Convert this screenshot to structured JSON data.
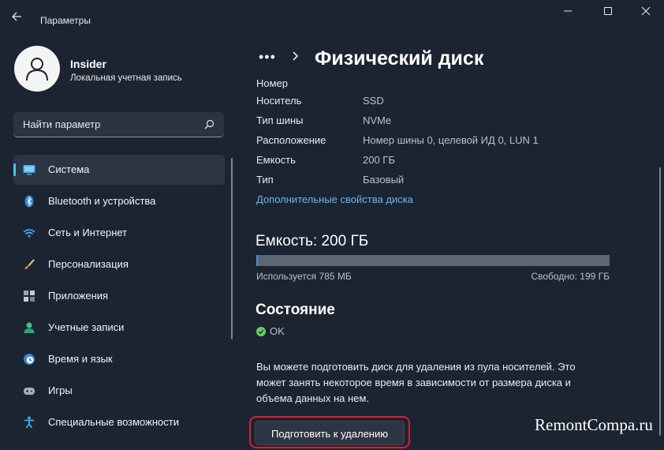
{
  "window": {
    "title": "Параметры"
  },
  "profile": {
    "name": "Insider",
    "account_type": "Локальная учетная запись"
  },
  "search": {
    "placeholder": "Найти параметр"
  },
  "nav": {
    "items": [
      {
        "label": "Система",
        "icon": "monitor-icon",
        "active": true
      },
      {
        "label": "Bluetooth и устройства",
        "icon": "bluetooth-icon"
      },
      {
        "label": "Сеть и Интернет",
        "icon": "wifi-icon"
      },
      {
        "label": "Персонализация",
        "icon": "brush-icon"
      },
      {
        "label": "Приложения",
        "icon": "apps-icon"
      },
      {
        "label": "Учетные записи",
        "icon": "person-icon"
      },
      {
        "label": "Время и язык",
        "icon": "globe-clock-icon"
      },
      {
        "label": "Игры",
        "icon": "gamepad-icon"
      },
      {
        "label": "Специальные возможности",
        "icon": "accessibility-icon"
      }
    ]
  },
  "breadcrumb": {
    "more": "•••",
    "title": "Физический диск"
  },
  "properties": {
    "partial_row": "Номер",
    "rows": [
      {
        "name": "Носитель",
        "value": "SSD"
      },
      {
        "name": "Тип шины",
        "value": "NVMe"
      },
      {
        "name": "Расположение",
        "value": "Номер шины 0, целевой ИД 0, LUN 1"
      },
      {
        "name": "Емкость",
        "value": "200 ГБ"
      },
      {
        "name": "Тип",
        "value": "Базовый"
      }
    ],
    "link": "Дополнительные свойства диска"
  },
  "capacity": {
    "title": "Емкость: 200 ГБ",
    "used_label": "Используется 785 МБ",
    "free_label": "Свободно: 199 ГБ",
    "used_fraction": 0.004
  },
  "state": {
    "title": "Состояние",
    "value": "OK"
  },
  "description": "Вы можете подготовить диск для удаления из пула носителей. Это может занять некоторое время в зависимости от размера диска и объема данных на нем.",
  "prepare_button": "Подготовить к удалению",
  "watermark": "RemontCompa.ru",
  "colors": {
    "background": "#1c2431",
    "accent": "#4cc2ff",
    "link": "#68b6f2",
    "highlight": "#d6202e",
    "ok_green": "#6ccb5f"
  }
}
